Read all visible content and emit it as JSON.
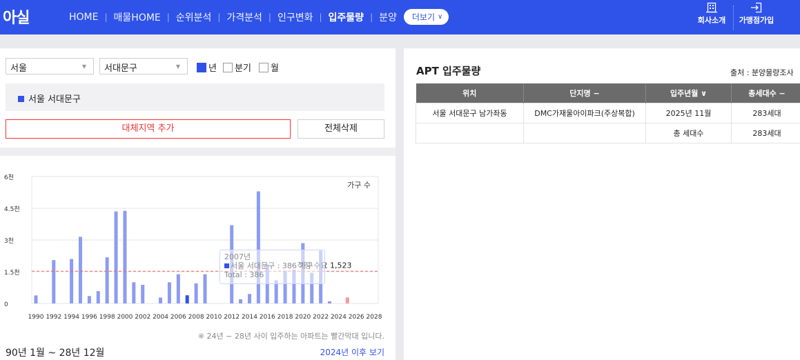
{
  "header": {
    "logo": "아실",
    "nav": [
      {
        "label": "HOME",
        "active": false
      },
      {
        "label": "매물HOME",
        "active": false
      },
      {
        "label": "순위분석",
        "active": false
      },
      {
        "label": "가격분석",
        "active": false
      },
      {
        "label": "인구변화",
        "active": false
      },
      {
        "label": "입주물량",
        "active": true
      },
      {
        "label": "분양",
        "active": false
      }
    ],
    "more_label": "더보기",
    "company_label": "회사소개",
    "join_label": "가맹점가입"
  },
  "filters": {
    "region": "서울",
    "district": "서대문구",
    "period_options": [
      {
        "label": "년",
        "checked": true
      },
      {
        "label": "분기",
        "checked": false
      },
      {
        "label": "월",
        "checked": false
      }
    ],
    "selected_region": "서울 서대문구",
    "add_label": "대체지역 추가",
    "delete_all_label": "전체삭제"
  },
  "chart_data": {
    "type": "bar",
    "legend": "가구 수",
    "ylim": [
      0,
      6000
    ],
    "yticks": [
      0,
      1500,
      3000,
      4500,
      6000
    ],
    "ytick_labels": [
      "0",
      "1.5천",
      "3천",
      "4.5천",
      "6천"
    ],
    "xtick_labels": [
      "1990",
      "1992",
      "1994",
      "1996",
      "1998",
      "2000",
      "2002",
      "2004",
      "2006",
      "2008",
      "2010",
      "2012",
      "2014",
      "2016",
      "2018",
      "2020",
      "2022",
      "2024",
      "2026",
      "2028"
    ],
    "x": [
      1990,
      1991,
      1992,
      1993,
      1994,
      1995,
      1996,
      1997,
      1998,
      1999,
      2000,
      2001,
      2002,
      2003,
      2004,
      2005,
      2006,
      2007,
      2008,
      2009,
      2010,
      2011,
      2012,
      2013,
      2014,
      2015,
      2016,
      2017,
      2018,
      2019,
      2020,
      2021,
      2022,
      2023,
      2024,
      2025,
      2026,
      2027,
      2028
    ],
    "values": [
      380,
      0,
      2050,
      0,
      2100,
      3150,
      350,
      580,
      2180,
      4350,
      4380,
      1000,
      880,
      0,
      280,
      1000,
      1380,
      386,
      950,
      1380,
      0,
      0,
      3700,
      200,
      450,
      5300,
      1850,
      1100,
      1550,
      1600,
      2850,
      1450,
      2500,
      100,
      0,
      283,
      0,
      0,
      0
    ],
    "future_from": 2024,
    "reference_line": {
      "value": 1523,
      "label": "적정 수요 1,523"
    },
    "colors": {
      "past": "#8c9cf0",
      "highlight": "#2f53e8",
      "future": "#f59a9a",
      "reference": "#f06060"
    }
  },
  "tooltip": {
    "year": "2007년",
    "line": "서울 서대문구 : 386 가구",
    "total": "Total : 386"
  },
  "chart_note": "※ 24년 ~ 28년 사이 입주하는 아파트는 빨간막대 입니다.",
  "range_label": "90년 1월 ~ 28년 12월",
  "after_link": "2024년 이후 보기",
  "apt": {
    "title": "APT 입주물량",
    "source": "출처 : 분양물량조사",
    "headers": [
      "위치",
      "단지명 −",
      "입주년월 ∨",
      "총세대수 −"
    ],
    "rows": [
      [
        "서울 서대문구 남가좌동",
        "DMC가재울아이파크(주상복합)",
        "2025년 11월",
        "283세대"
      ],
      [
        "",
        "",
        "총 세대수",
        "283세대"
      ]
    ]
  }
}
